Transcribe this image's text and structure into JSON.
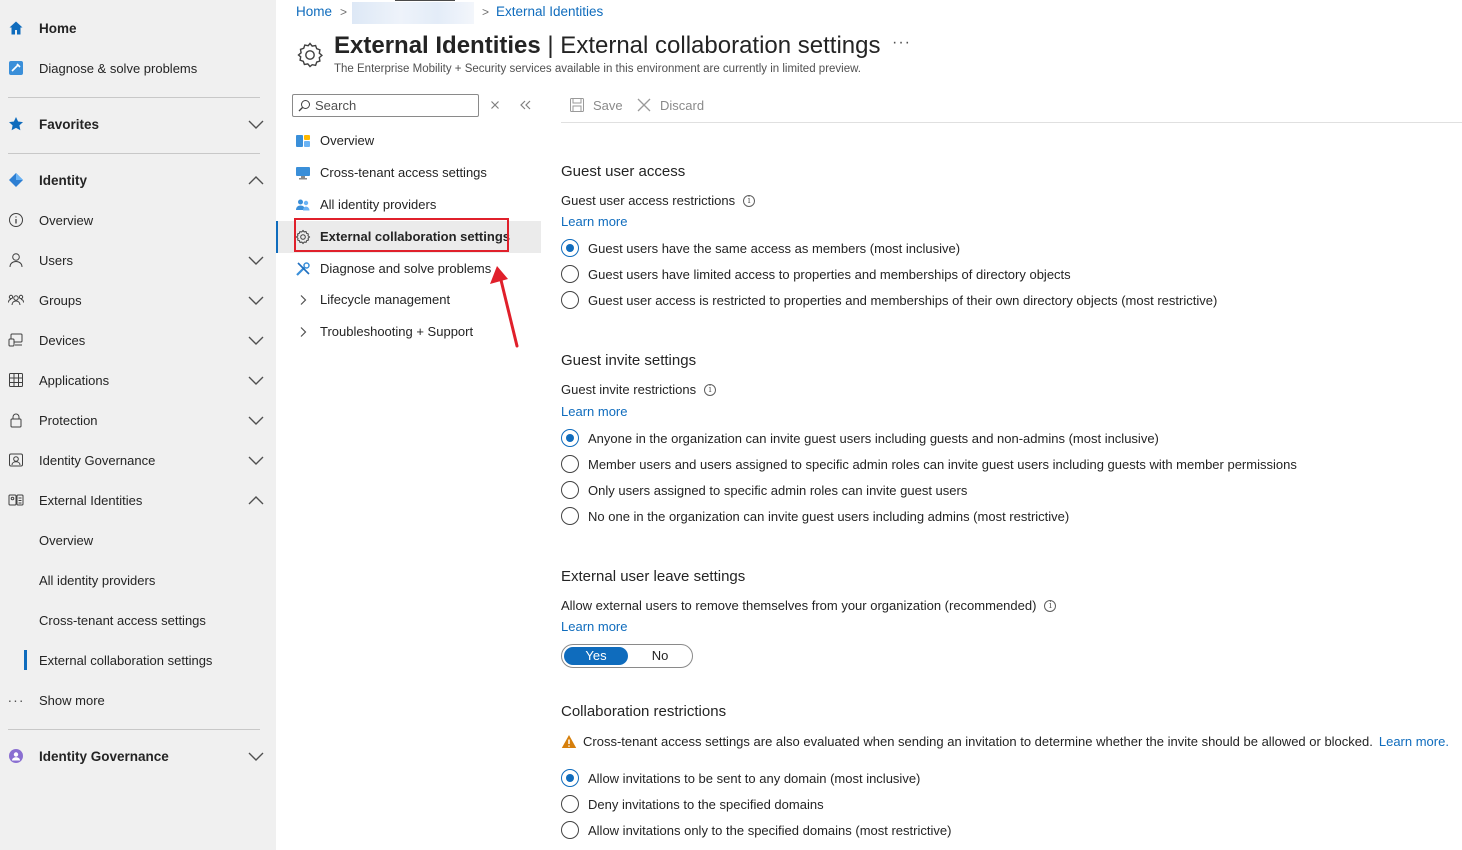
{
  "left_nav": {
    "home": "Home",
    "diagnose": "Diagnose & solve problems",
    "favorites": "Favorites",
    "identity": "Identity",
    "identity_items": [
      "Overview",
      "Users",
      "Groups",
      "Devices",
      "Applications",
      "Protection",
      "Identity Governance",
      "External Identities"
    ],
    "external_sub_items": [
      "Overview",
      "All identity providers",
      "Cross-tenant access settings",
      "External collaboration settings"
    ],
    "show_more": "Show more",
    "identity_governance": "Identity Governance"
  },
  "breadcrumb": {
    "home": "Home",
    "current": "External Identities"
  },
  "header": {
    "title_bold": "External Identities",
    "title_rest": " | External collaboration settings",
    "subtitle": "The Enterprise Mobility + Security services available in this environment are currently in limited preview.",
    "more": "···"
  },
  "resource_menu": {
    "search_placeholder": "Search",
    "items": [
      "Overview",
      "Cross-tenant access settings",
      "All identity providers",
      "External collaboration settings",
      "Diagnose and solve problems",
      "Lifecycle management",
      "Troubleshooting + Support"
    ],
    "selected_index": 3
  },
  "toolbar": {
    "save": "Save",
    "discard": "Discard"
  },
  "guest_access": {
    "heading": "Guest user access",
    "label": "Guest user access restrictions",
    "learn_more": "Learn more",
    "options": [
      "Guest users have the same access as members (most inclusive)",
      "Guest users have limited access to properties and memberships of directory objects",
      "Guest user access is restricted to properties and memberships of their own directory objects (most restrictive)"
    ],
    "selected": 0
  },
  "guest_invite": {
    "heading": "Guest invite settings",
    "label": "Guest invite restrictions",
    "learn_more": "Learn more",
    "options": [
      "Anyone in the organization can invite guest users including guests and non-admins (most inclusive)",
      "Member users and users assigned to specific admin roles can invite guest users including guests with member permissions",
      "Only users assigned to specific admin roles can invite guest users",
      "No one in the organization can invite guest users including admins (most restrictive)"
    ],
    "selected": 0
  },
  "leave_settings": {
    "heading": "External user leave settings",
    "label": "Allow external users to remove themselves from your organization (recommended)",
    "learn_more": "Learn more",
    "yes": "Yes",
    "no": "No",
    "value": "Yes"
  },
  "collab_restrictions": {
    "heading": "Collaboration restrictions",
    "warning": "Cross-tenant access settings are also evaluated when sending an invitation to determine whether the invite should be allowed or blocked.",
    "warning_link": "Learn more.",
    "options": [
      "Allow invitations to be sent to any domain (most inclusive)",
      "Deny invitations to the specified domains",
      "Allow invitations only to the specified domains (most restrictive)"
    ],
    "selected": 0
  },
  "colors": {
    "accent": "#0f6cbd",
    "highlight_box": "#e0202b",
    "annotation_arrow": "#e0202b",
    "nav_bg": "#f0f0f0"
  }
}
